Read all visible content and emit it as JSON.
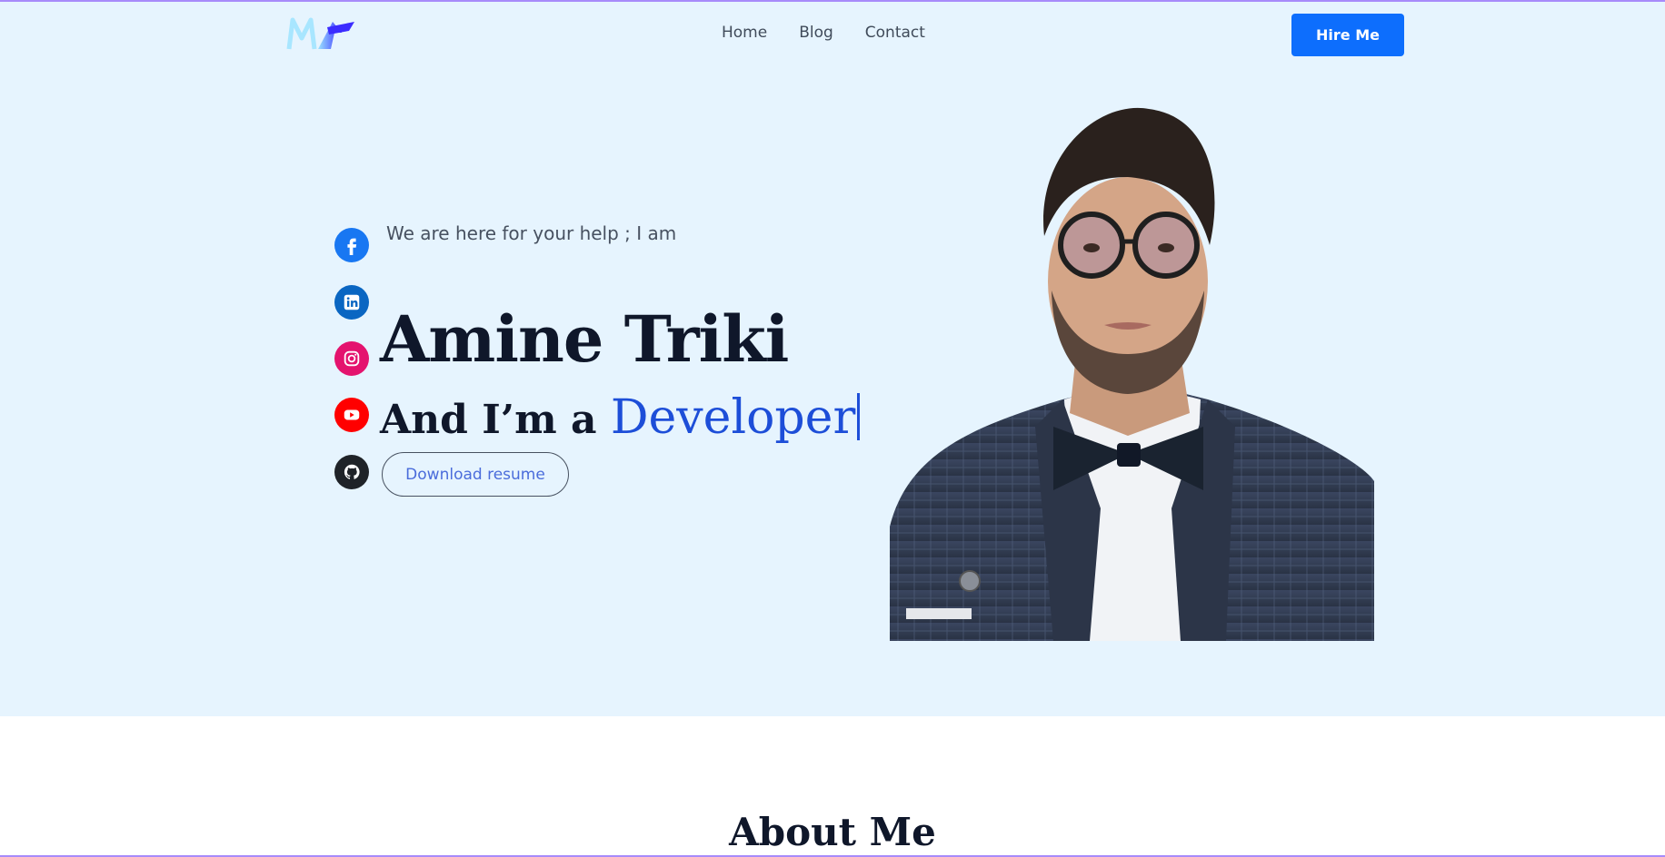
{
  "nav": {
    "links": [
      "Home",
      "Blog",
      "Contact"
    ],
    "hire_label": "Hire Me",
    "logo_icon": "ma-monogram-logo"
  },
  "hero": {
    "tagline": "We are here for your help ; I am",
    "name": "Amine Triki",
    "role_prefix": "And I’m a",
    "role_word": "Developer",
    "resume_label": "Download resume",
    "social_icons": [
      "facebook-icon",
      "linkedin-icon",
      "instagram-icon",
      "youtube-icon",
      "github-icon"
    ],
    "portrait_icon": "profile-portrait"
  },
  "about": {
    "title": "About Me"
  },
  "colors": {
    "hero_bg": "#e6f4fe",
    "accent": "#0d6efd",
    "role_word": "#1d4ed8",
    "heading": "#0f172a"
  }
}
